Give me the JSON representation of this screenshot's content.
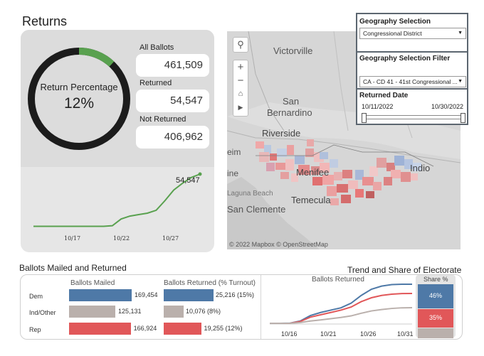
{
  "returns": {
    "title": "Returns",
    "gauge_label": "Return Percentage",
    "gauge_value": "12%",
    "gauge_fraction": 0.12,
    "all_ballots_label": "All Ballots",
    "all_ballots_value": "461,509",
    "returned_label": "Returned",
    "returned_value": "54,547",
    "not_returned_label": "Not Returned",
    "not_returned_value": "406,962",
    "trend_end_label": "54,547",
    "trend_x_ticks": [
      "10/17",
      "10/22",
      "10/27"
    ]
  },
  "map": {
    "place_labels": [
      "Victorville",
      "San",
      "Bernardino",
      "Riverside",
      "Menifee",
      "Temecula",
      "Indio",
      "San Clemente",
      "Laguna Beach",
      "ine",
      "eim"
    ],
    "attribution": "© 2022 Mapbox © OpenStreetMap",
    "controls": [
      "search-icon",
      "zoom-in-icon",
      "zoom-out-icon",
      "home-icon",
      "play-icon"
    ]
  },
  "filters": {
    "geo_selection_title": "Geography Selection",
    "geo_selection_value": "Congressional District",
    "geo_filter_title": "Geography Selection Filter",
    "geo_filter_value": "CA - CD 41 - 41st Congressional ...",
    "returned_date_title": "Returned Date",
    "date_start": "10/11/2022",
    "date_end": "10/30/2022"
  },
  "mailed": {
    "title": "Ballots Mailed and Returned",
    "col1_header": "Ballots Mailed",
    "col2_header": "Ballots Returned (% Turnout)",
    "rows": [
      {
        "party": "Dem",
        "mailed": "169,454",
        "returned": "25,216 (15%)",
        "mailed_value": 169454,
        "returned_value": 25216,
        "color": "#4e79a7"
      },
      {
        "party": "Ind/Other",
        "mailed": "125,131",
        "returned": "10,076 (8%)",
        "mailed_value": 125131,
        "returned_value": 10076,
        "color": "#bab0ac"
      },
      {
        "party": "Rep",
        "mailed": "166,924",
        "returned": "19,255 (12%)",
        "mailed_value": 166924,
        "returned_value": 19255,
        "color": "#e15759"
      }
    ]
  },
  "trend": {
    "title": "Trend and Share of Electorate",
    "chart_header": "Ballots Returned",
    "share_header": "Share %",
    "x_ticks": [
      "10/16",
      "10/21",
      "10/26",
      "10/31"
    ],
    "share": [
      {
        "label": "46%",
        "value": 46,
        "color": "#4e79a7"
      },
      {
        "label": "35%",
        "value": 35,
        "color": "#e15759"
      },
      {
        "label": "",
        "value": 19,
        "color": "#bab0ac"
      }
    ]
  },
  "chart_data": [
    {
      "type": "line",
      "x": [
        "10/11",
        "10/12",
        "10/13",
        "10/14",
        "10/15",
        "10/16",
        "10/17",
        "10/18",
        "10/19",
        "10/20",
        "10/21",
        "10/22",
        "10/23",
        "10/24",
        "10/25",
        "10/26",
        "10/27",
        "10/28",
        "10/29",
        "10/30"
      ],
      "values": [
        400,
        400,
        400,
        400,
        400,
        400,
        400,
        400,
        400,
        1000,
        8000,
        11000,
        12500,
        14000,
        17000,
        27000,
        38000,
        45000,
        51000,
        54547
      ],
      "x_ticks": [
        "10/17",
        "10/22",
        "10/27"
      ],
      "annotation": "54,547",
      "color": "#59a14f"
    },
    {
      "type": "line",
      "x": [
        "10/13",
        "10/16",
        "10/18",
        "10/20",
        "10/21",
        "10/22",
        "10/23",
        "10/24",
        "10/25",
        "10/26",
        "10/27",
        "10/28",
        "10/29",
        "10/30",
        "10/31"
      ],
      "x_ticks": [
        "10/16",
        "10/21",
        "10/26",
        "10/31"
      ],
      "series": [
        {
          "values": [
            0,
            0,
            100,
            1500,
            5000,
            7000,
            8500,
            10000,
            13000,
            18000,
            22000,
            24000,
            25000,
            25200,
            25216
          ],
          "color": "#4e79a7"
        },
        {
          "values": [
            0,
            0,
            80,
            1200,
            4000,
            5500,
            7000,
            8500,
            10500,
            14000,
            16500,
            18000,
            18800,
            19200,
            19255
          ],
          "color": "#e15759"
        },
        {
          "values": [
            0,
            0,
            40,
            500,
            1500,
            2200,
            3000,
            3800,
            4800,
            6500,
            8000,
            8900,
            9600,
            10000,
            10076
          ],
          "color": "#bab0ac"
        }
      ]
    },
    {
      "type": "bar",
      "categories": [
        "Dem",
        "Ind/Other",
        "Rep"
      ],
      "series": [
        {
          "name": "Ballots Mailed",
          "values": [
            169454,
            125131,
            166924
          ]
        },
        {
          "name": "Ballots Returned (% Turnout)",
          "values": [
            25216,
            10076,
            19255
          ]
        }
      ]
    }
  ]
}
